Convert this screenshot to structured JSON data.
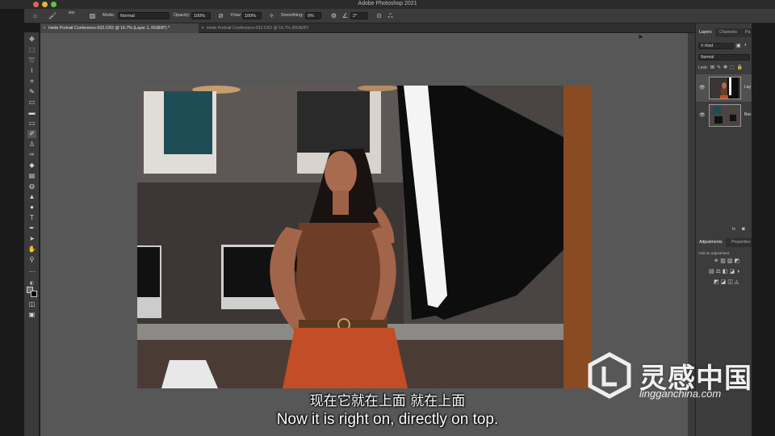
{
  "window": {
    "title": "Adobe Photoshop 2021"
  },
  "options_bar": {
    "brush_size": "900",
    "mode_label": "Mode:",
    "mode_value": "Normal",
    "opacity_label": "Opacity:",
    "opacity_value": "100%",
    "flow_label": "Flow:",
    "flow_value": "100%",
    "smoothing_label": "Smoothing:",
    "smoothing_value": "0%",
    "angle_value": "2°"
  },
  "tabs": [
    {
      "label": "Hede Portrait Conference-032.CR2 @ 16.7% (Layer 1, RGB/8*) *",
      "active": true
    },
    {
      "label": "Hede Portrait Conference-033.CR2 @ 16.7% (RGB/8*)",
      "active": false
    }
  ],
  "layers_panel": {
    "tabs": [
      "Layers",
      "Channels",
      "Pa"
    ],
    "kind_filter": "Kind",
    "blend_mode": "Normal",
    "lock_label": "Lock:",
    "layers": [
      {
        "name": "Lay",
        "visible": true,
        "selected": true
      },
      {
        "name": "Bac",
        "visible": true,
        "selected": false
      }
    ]
  },
  "adjustments_panel": {
    "tabs": [
      "Adjustments",
      "Properties"
    ],
    "hint": "Add an adjustment"
  },
  "subtitles": {
    "zh": "现在它就在上面 就在上面",
    "en": "Now it is right on, directly on top."
  },
  "watermark": {
    "brand": "灵感中国",
    "url": "lingganchina.com"
  },
  "icons": [
    "home-icon",
    "brush-icon",
    "pressure-opacity-icon",
    "airbrush-icon",
    "pressure-size-icon",
    "butterfly-icon",
    "eye-icon"
  ]
}
